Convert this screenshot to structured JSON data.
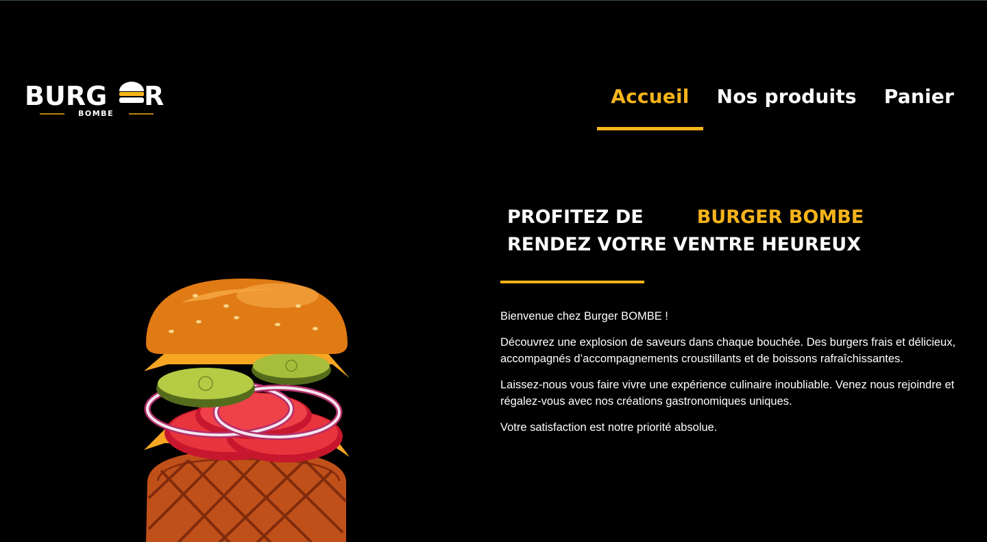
{
  "logo": {
    "main_text": "BURG",
    "trail_text": "R",
    "sub_text": "BOMBE"
  },
  "nav": {
    "items": [
      {
        "label": "Accueil",
        "active": true
      },
      {
        "label": "Nos produits",
        "active": false
      },
      {
        "label": "Panier",
        "active": false
      }
    ]
  },
  "hero": {
    "line1_prefix": "PROFITEZ DE",
    "line1_brand": "BURGER BOMBE",
    "line2": "RENDEZ VOTRE VENTRE HEUREUX",
    "paragraphs": [
      "Bienvenue chez Burger BOMBE  !",
      "Découvrez une explosion de saveurs dans chaque bouchée. Des burgers frais et délicieux, accompagnés d’accompagnements croustillants et de boissons rafraîchissantes.",
      "Laissez-nous vous faire vivre une expérience culinaire inoubliable. Venez nous rejoindre et régalez-vous avec nos créations gastronomiques uniques.",
      "Votre satisfaction est notre priorité absolue."
    ]
  },
  "colors": {
    "accent": "#F6B41B",
    "background": "#000000",
    "text": "#FFFFFF"
  }
}
